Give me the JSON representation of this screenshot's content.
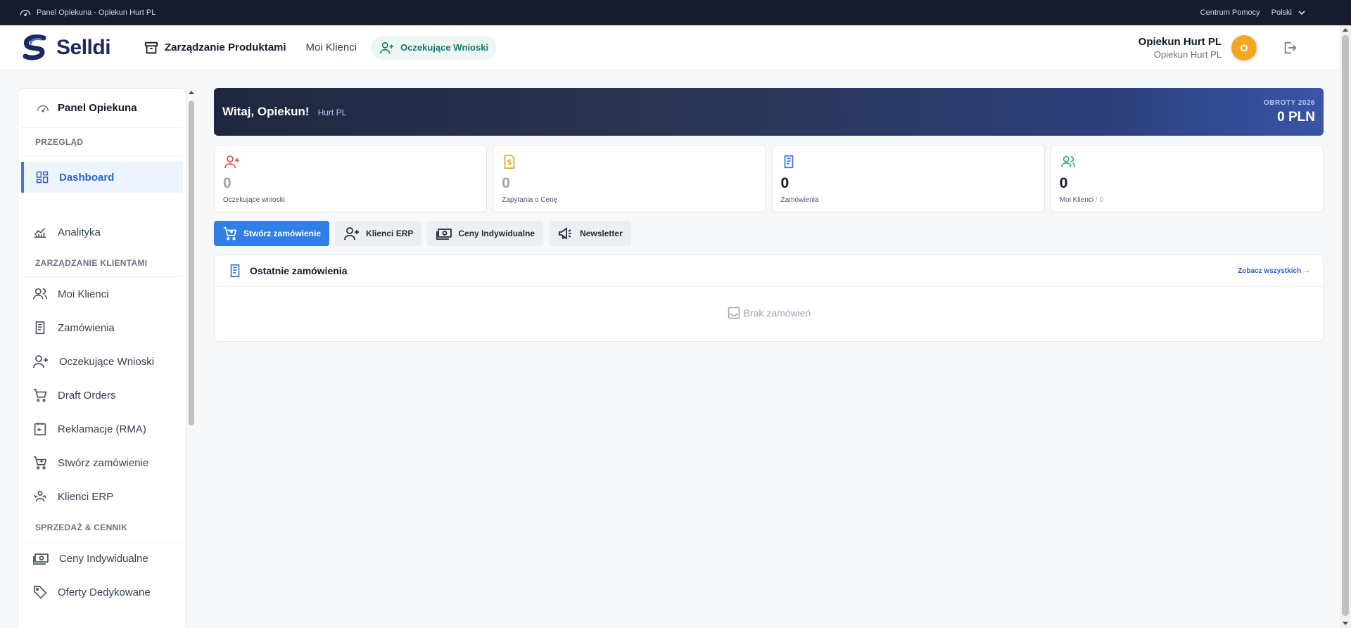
{
  "topbar": {
    "title": "Panel Opiekuna - Opiekun Hurt PL",
    "help": "Centrum Pomocy",
    "language": "Polski"
  },
  "header": {
    "logo": "Selldi",
    "nav": {
      "products": "Zarządzanie Produktami",
      "clients": "Moi Klienci",
      "pending": "Oczekujące Wnioski"
    },
    "user": {
      "name": "Opiekun Hurt PL",
      "role": "Opiekun Hurt PL",
      "initial": "O"
    }
  },
  "sidebar": {
    "title": "Panel Opiekuna",
    "sections": {
      "overview": "PRZEGLĄD",
      "clients": "ZARZĄDZANIE KLIENTAMI",
      "sales": "SPRZEDAŻ & CENNIK"
    },
    "items": {
      "dashboard": "Dashboard",
      "analytics": "Analityka",
      "my_clients": "Moi Klienci",
      "orders": "Zamówienia",
      "pending": "Oczekujące Wnioski",
      "drafts": "Draft Orders",
      "rma": "Reklamacje (RMA)",
      "create_order": "Stwórz zamówienie",
      "erp_clients": "Klienci ERP",
      "individual_prices": "Ceny Indywidualne",
      "dedicated_offers": "Oferty Dedykowane"
    }
  },
  "hero": {
    "greeting": "Witaj, Opiekun!",
    "company": "Hurt PL",
    "revenue_label": "OBROTY 2026",
    "revenue_value": "0 PLN"
  },
  "stats": [
    {
      "value": "0",
      "label": "Oczekujące wnioski",
      "icon": "user-plus-icon",
      "color": "#e05252"
    },
    {
      "value": "0",
      "label": "Zapytania o Cenę",
      "icon": "price-doc-icon",
      "color": "#e0a325"
    },
    {
      "value": "0",
      "label": "Zamówienia",
      "icon": "receipt-icon",
      "color": "#3b6fd6"
    },
    {
      "value": "0",
      "label": "Moi Klienci",
      "label_suffix": "/ 0",
      "icon": "users-icon",
      "color": "#2fae6a"
    }
  ],
  "actions": {
    "create_order": "Stwórz zamówienie",
    "erp_clients": "Klienci ERP",
    "individual_prices": "Ceny Indywidualne",
    "newsletter": "Newsletter"
  },
  "recent_orders": {
    "title": "Ostatnie zamówienia",
    "see_all": "Zobacz wszystkich →",
    "empty": "Brak zamówień"
  }
}
